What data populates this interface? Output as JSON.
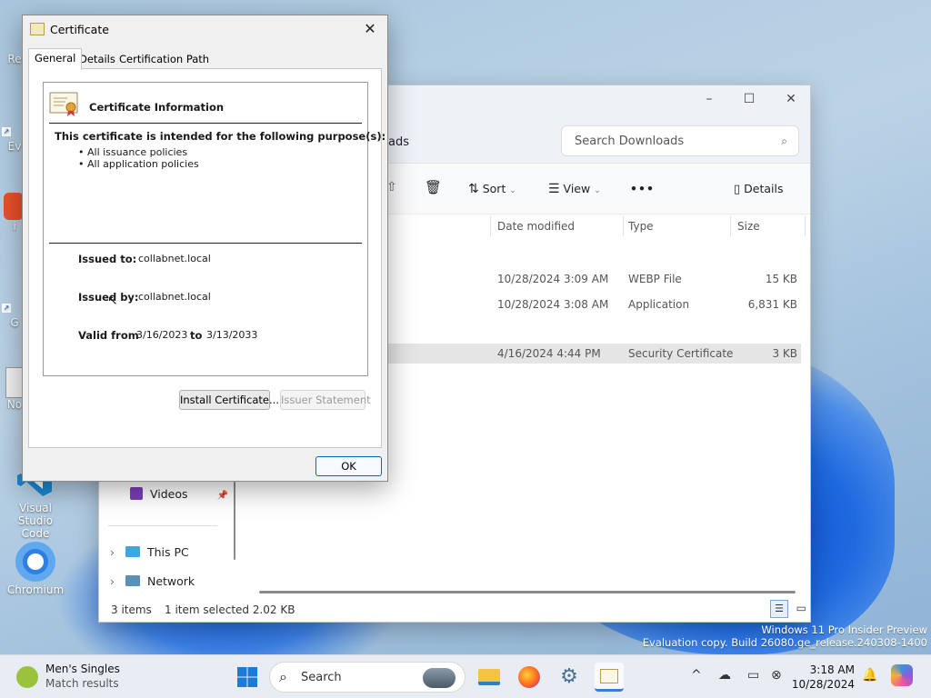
{
  "desktop": {
    "icons": [
      {
        "label": "Re",
        "top": 0
      },
      {
        "label": "Ev",
        "top": 0
      },
      {
        "label": "i",
        "top": 0
      },
      {
        "label": "G",
        "top": 0
      },
      {
        "label": "No",
        "top": 0
      },
      {
        "label": "Visual Studio Code",
        "top": 0
      },
      {
        "label": "Chromium",
        "top": 0
      }
    ]
  },
  "explorer": {
    "breadcrumb": "ads",
    "search_placeholder": "Search Downloads",
    "toolbar": {
      "sort": "Sort",
      "view": "View",
      "more": "•••",
      "details": "Details"
    },
    "columns": {
      "date": "Date modified",
      "type": "Type",
      "size": "Size"
    },
    "files": [
      {
        "date": "10/28/2024 3:09 AM",
        "type": "WEBP File",
        "size": "15 KB"
      },
      {
        "date": "10/28/2024 3:08 AM",
        "type": "Application",
        "size": "6,831 KB"
      },
      {
        "date": "4/16/2024 4:44 PM",
        "type": "Security Certificate",
        "size": "3 KB"
      }
    ],
    "nav": {
      "videos": "Videos",
      "this_pc": "This PC",
      "network": "Network"
    },
    "status": {
      "items": "3 items",
      "selected": "1 item selected  2.02 KB"
    }
  },
  "certificate": {
    "title": "Certificate",
    "tabs": [
      "General",
      "Details",
      "Certification Path"
    ],
    "info_title": "Certificate Information",
    "purpose_heading": "This certificate is intended for the following purpose(s):",
    "purposes": [
      "• All issuance policies",
      "• All application policies"
    ],
    "issued_to_label": "Issued to:",
    "issued_to": "collabnet.local",
    "issued_by_label": "Issued by:",
    "issued_by": "collabnet.local",
    "valid_from_label": "Valid from",
    "valid_from": "3/16/2023",
    "to_label": "to",
    "valid_to": "3/13/2033",
    "install_button": "Install Certificate...",
    "issuer_statement_button": "Issuer Statement",
    "ok_button": "OK"
  },
  "taskbar": {
    "weather_title": "Men's Singles",
    "weather_sub": "Match results",
    "search_label": "Search",
    "time": "3:18 AM",
    "date": "10/28/2024"
  },
  "watermark": {
    "line1": "Windows 11 Pro Insider Preview",
    "line2": "Evaluation copy. Build 26080.ge_release.240308-1400"
  }
}
